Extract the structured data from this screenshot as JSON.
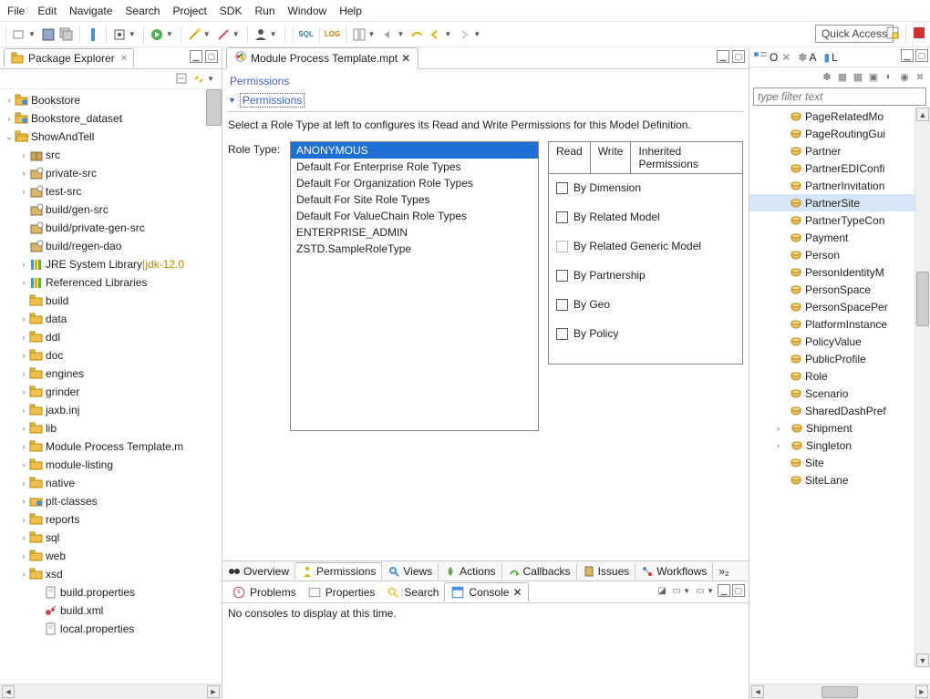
{
  "menu": [
    "File",
    "Edit",
    "Navigate",
    "Search",
    "Project",
    "SDK",
    "Run",
    "Window",
    "Help"
  ],
  "quick_access": "Quick Access",
  "package_explorer": {
    "title": "Package Explorer",
    "tree": [
      {
        "level": 1,
        "exp": ">",
        "icon": "proj-java",
        "label": "Bookstore"
      },
      {
        "level": 1,
        "exp": ">",
        "icon": "proj-java",
        "label": "Bookstore_dataset"
      },
      {
        "level": 1,
        "exp": "v",
        "icon": "proj-open",
        "label": "ShowAndTell"
      },
      {
        "level": 2,
        "exp": ">",
        "icon": "pkg",
        "label": "src"
      },
      {
        "level": 2,
        "exp": ">",
        "icon": "pkg-priv",
        "label": "private-src"
      },
      {
        "level": 2,
        "exp": ">",
        "icon": "pkg-priv",
        "label": "test-src"
      },
      {
        "level": 2,
        "exp": "",
        "icon": "pkg-priv",
        "label": "build/gen-src"
      },
      {
        "level": 2,
        "exp": "",
        "icon": "pkg-priv",
        "label": "build/private-gen-src"
      },
      {
        "level": 2,
        "exp": "",
        "icon": "pkg-priv",
        "label": "build/regen-dao"
      },
      {
        "level": 2,
        "exp": ">",
        "icon": "lib",
        "label": "JRE System Library",
        "decor": "[jdk-12.0"
      },
      {
        "level": 2,
        "exp": ">",
        "icon": "lib",
        "label": "Referenced Libraries"
      },
      {
        "level": 2,
        "exp": "",
        "icon": "folder",
        "label": "build"
      },
      {
        "level": 2,
        "exp": ">",
        "icon": "folder",
        "label": "data"
      },
      {
        "level": 2,
        "exp": ">",
        "icon": "folder",
        "label": "ddl"
      },
      {
        "level": 2,
        "exp": ">",
        "icon": "folder",
        "label": "doc"
      },
      {
        "level": 2,
        "exp": ">",
        "icon": "folder",
        "label": "engines"
      },
      {
        "level": 2,
        "exp": ">",
        "icon": "folder",
        "label": "grinder"
      },
      {
        "level": 2,
        "exp": ">",
        "icon": "folder",
        "label": "jaxb.inj"
      },
      {
        "level": 2,
        "exp": ">",
        "icon": "folder",
        "label": "lib"
      },
      {
        "level": 2,
        "exp": ">",
        "icon": "folder",
        "label": "Module Process Template.m"
      },
      {
        "level": 2,
        "exp": ">",
        "icon": "folder",
        "label": "module-listing"
      },
      {
        "level": 2,
        "exp": ">",
        "icon": "folder",
        "label": "native"
      },
      {
        "level": 2,
        "exp": ">",
        "icon": "folder-web",
        "label": "plt-classes"
      },
      {
        "level": 2,
        "exp": ">",
        "icon": "folder",
        "label": "reports"
      },
      {
        "level": 2,
        "exp": ">",
        "icon": "folder",
        "label": "sql"
      },
      {
        "level": 2,
        "exp": ">",
        "icon": "folder",
        "label": "web"
      },
      {
        "level": 2,
        "exp": ">",
        "icon": "folder",
        "label": "xsd"
      },
      {
        "level": 3,
        "exp": "",
        "icon": "file",
        "label": "build.properties"
      },
      {
        "level": 3,
        "exp": "",
        "icon": "ant",
        "label": "build.xml"
      },
      {
        "level": 3,
        "exp": "",
        "icon": "file",
        "label": "local.properties"
      }
    ]
  },
  "editor": {
    "tab_title": "Module Process Template.mpt",
    "breadcrumb": "Permissions",
    "section": "Permissions",
    "instruction": "Select a Role Type at left to configures its Read and Write Permissions for this Model Definition.",
    "role_label": "Role Type:",
    "role_types": [
      "ANONYMOUS",
      "Default For Enterprise Role Types",
      "Default For Organization Role Types",
      "Default For Site Role Types",
      "Default For ValueChain Role Types",
      "ENTERPRISE_ADMIN",
      "ZSTD.SampleRoleType"
    ],
    "role_selected": 0,
    "perm_tabs": [
      "Read",
      "Write",
      "Inherited Permissions"
    ],
    "perm_checks": [
      {
        "label": "By Dimension",
        "disabled": false
      },
      {
        "label": "By Related Model",
        "disabled": false
      },
      {
        "label": "By Related Generic Model",
        "disabled": true
      },
      {
        "label": "By Partnership",
        "disabled": false
      },
      {
        "label": "By Geo",
        "disabled": false
      },
      {
        "label": "By Policy",
        "disabled": false
      }
    ],
    "bottom_tabs": [
      {
        "icon": "overview",
        "label": "Overview"
      },
      {
        "icon": "perm",
        "label": "Permissions",
        "active": true
      },
      {
        "icon": "views",
        "label": "Views"
      },
      {
        "icon": "actions",
        "label": "Actions"
      },
      {
        "icon": "callbacks",
        "label": "Callbacks"
      },
      {
        "icon": "issues",
        "label": "Issues"
      },
      {
        "icon": "workflows",
        "label": "Workflows"
      }
    ]
  },
  "console": {
    "tabs": [
      "Problems",
      "Properties",
      "Search",
      "Console"
    ],
    "active": 3,
    "message": "No consoles to display at this time."
  },
  "outline": {
    "tabs": [
      "O",
      "",
      "A",
      "L"
    ],
    "filter_placeholder": "type filter text",
    "items": [
      {
        "label": "PageRelatedMo"
      },
      {
        "label": "PageRoutingGui"
      },
      {
        "label": "Partner"
      },
      {
        "label": "PartnerEDIConfi"
      },
      {
        "label": "PartnerInvitation"
      },
      {
        "label": "PartnerSite",
        "selected": true
      },
      {
        "label": "PartnerTypeCon"
      },
      {
        "label": "Payment"
      },
      {
        "label": "Person"
      },
      {
        "label": "PersonIdentityM"
      },
      {
        "label": "PersonSpace"
      },
      {
        "label": "PersonSpacePer"
      },
      {
        "label": "PlatformInstance"
      },
      {
        "label": "PolicyValue"
      },
      {
        "label": "PublicProfile"
      },
      {
        "label": "Role"
      },
      {
        "label": "Scenario"
      },
      {
        "label": "SharedDashPref"
      },
      {
        "label": "Shipment",
        "exp": ">"
      },
      {
        "label": "Singleton",
        "exp": ">"
      },
      {
        "label": "Site"
      },
      {
        "label": "SiteLane"
      }
    ]
  }
}
